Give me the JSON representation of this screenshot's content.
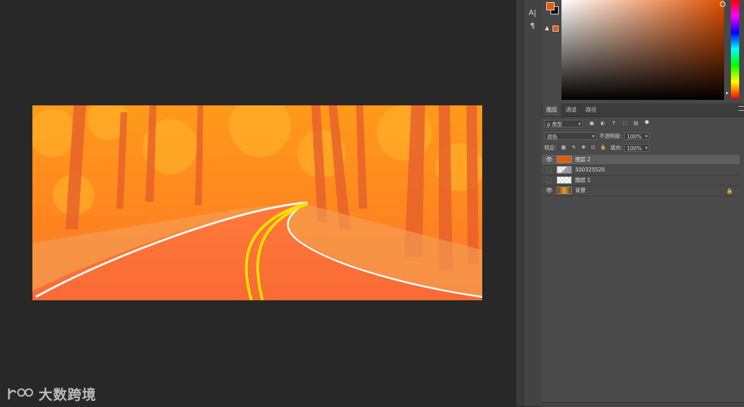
{
  "watermark": {
    "text": "大数跨境"
  },
  "side_toolbar": {
    "character_glyph": "A|",
    "paragraph_glyph": "¶"
  },
  "color_panel": {
    "foreground_color": "#e65a00",
    "background_color": "#111111",
    "gamut_warning_icon": "warning-icon",
    "hue_marker": "▸"
  },
  "layers_panel": {
    "tabs": [
      "图层",
      "通道",
      "路径"
    ],
    "active_tab": "图层",
    "filter_kind": "ρ 类型",
    "blend_mode": "滤色",
    "opacity_label": "不透明度:",
    "opacity_value": "100%",
    "lock_label": "锁定:",
    "fill_label": "填充:",
    "fill_value": "100%",
    "layers": [
      {
        "name": "图层 2",
        "visible": true,
        "selected": true,
        "thumb": "orange"
      },
      {
        "name": "500325520",
        "visible": false,
        "selected": false,
        "thumb": "smart"
      },
      {
        "name": "图层 1",
        "visible": false,
        "selected": false,
        "thumb": "transparent"
      },
      {
        "name": "背景",
        "visible": true,
        "selected": false,
        "thumb": "photo",
        "locked": true
      }
    ]
  },
  "colors": {
    "accent_orange": "#e65a00",
    "panel_bg": "#4a4a4a",
    "canvas_bg": "#282828"
  }
}
